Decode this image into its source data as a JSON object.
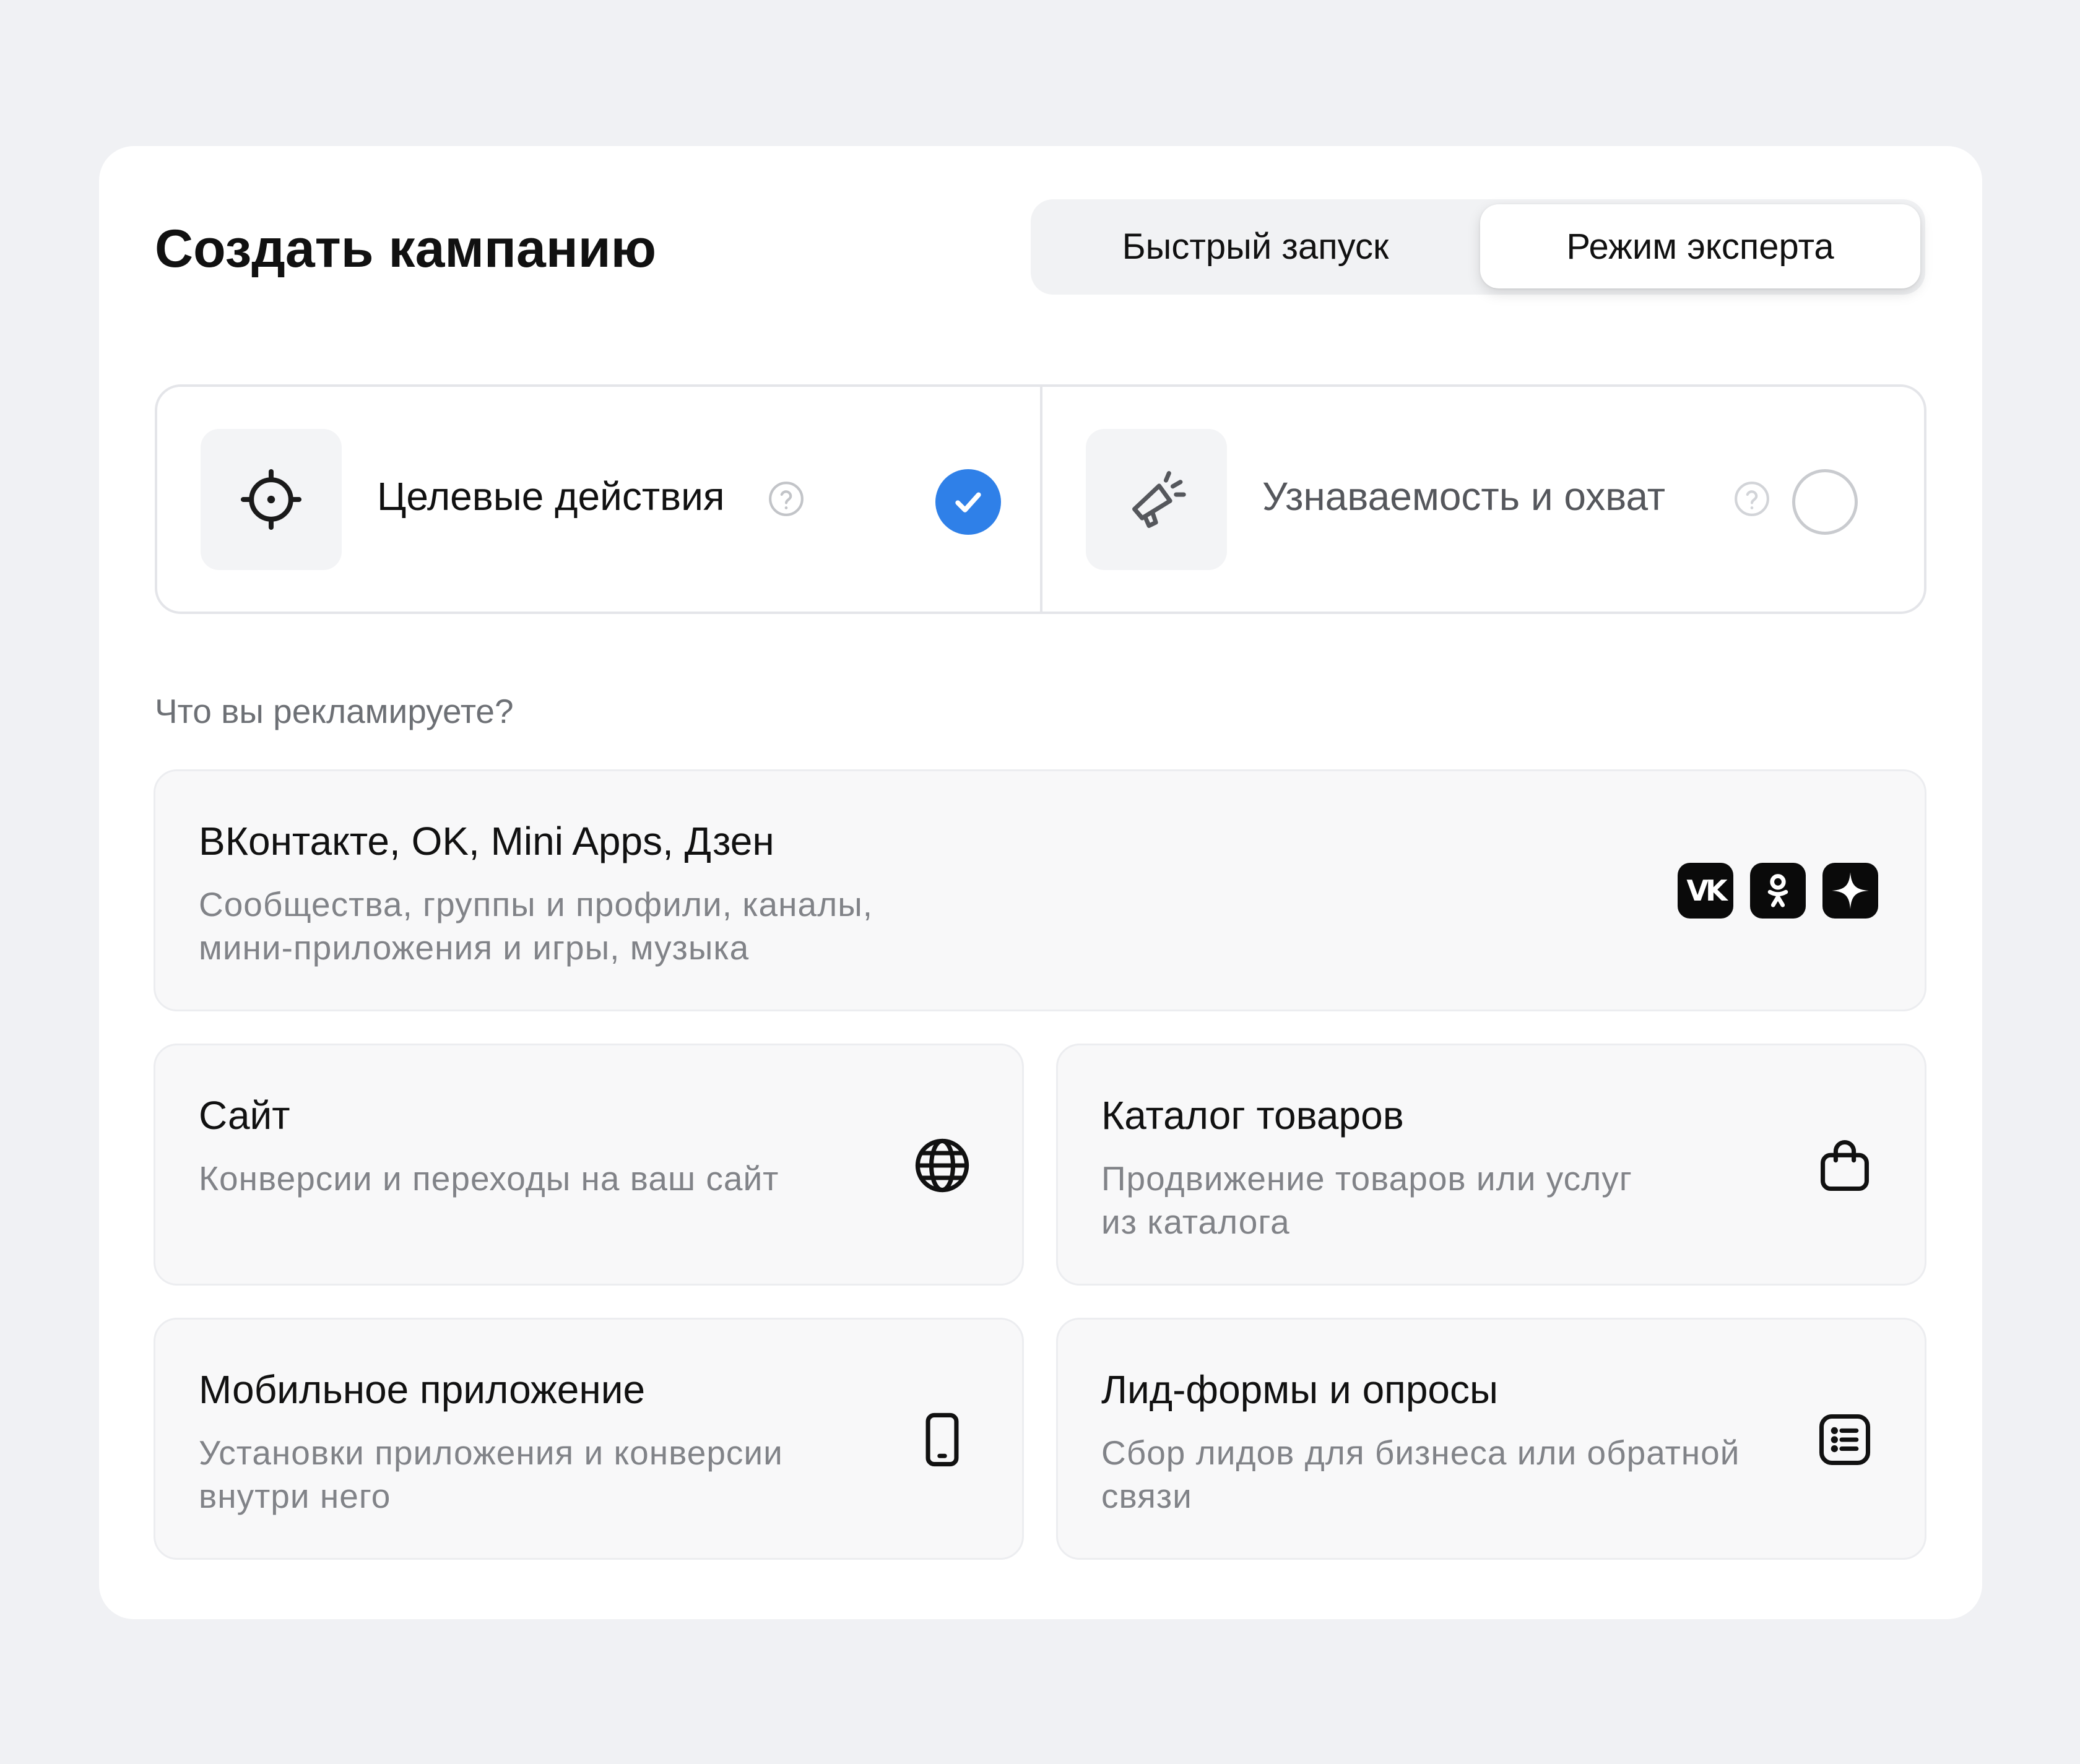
{
  "header": {
    "title": "Создать кампанию",
    "modes": [
      {
        "label": "Быстрый запуск",
        "active": false
      },
      {
        "label": "Режим эксперта",
        "active": true
      }
    ]
  },
  "goals": [
    {
      "label": "Целевые действия",
      "icon": "target-icon",
      "selected": true
    },
    {
      "label": "Узнаваемость и охват",
      "icon": "megaphone-icon",
      "selected": false
    }
  ],
  "promote": {
    "question": "Что вы рекламируете?",
    "options": [
      {
        "title": "ВКонтакте, OK, Mini Apps, Дзен",
        "subtitle_lines": [
          "Сообщества, группы и профили, каналы,",
          "мини-приложения и игры, музыка"
        ],
        "icons": [
          "vk-icon",
          "ok-icon",
          "dzen-icon"
        ],
        "vk_glyph": "VK"
      },
      {
        "title": "Сайт",
        "subtitle_lines": [
          "Конверсии и переходы на ваш сайт"
        ],
        "icon": "globe-icon"
      },
      {
        "title": "Каталог товаров",
        "subtitle_lines": [
          "Продвижение товаров или услуг",
          "из каталога"
        ],
        "icon": "shopping-bag-icon"
      },
      {
        "title": "Мобильное приложение",
        "subtitle_lines": [
          "Установки приложения и конверсии",
          "внутри него"
        ],
        "icon": "smartphone-icon"
      },
      {
        "title": "Лид-формы и опросы",
        "subtitle_lines": [
          "Сбор лидов для бизнеса или обратной",
          "связи"
        ],
        "icon": "form-list-icon"
      }
    ]
  },
  "colors": {
    "accent": "#2f80e8",
    "page_background": "#f0f1f4",
    "card_background": "#ffffff",
    "option_background": "#f8f8f9"
  }
}
